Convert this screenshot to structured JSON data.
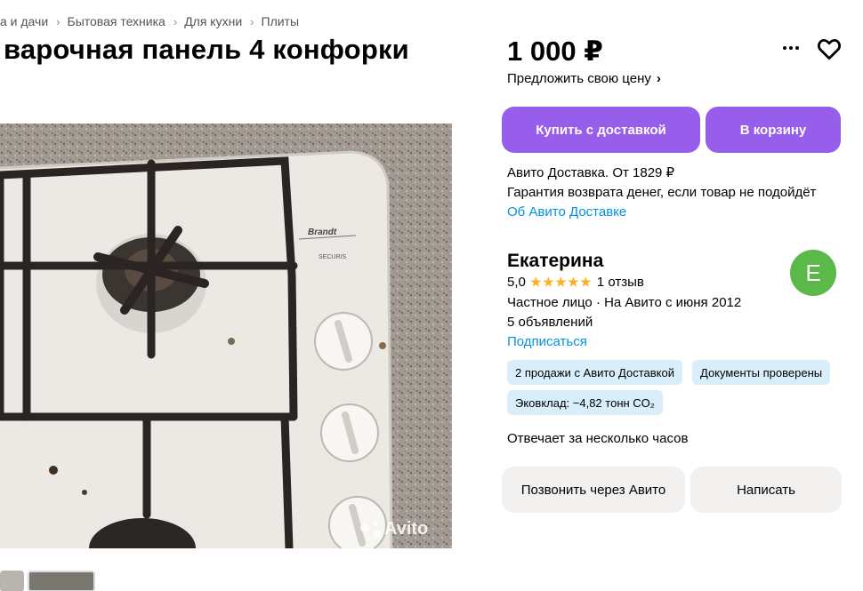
{
  "breadcrumbs": [
    "а и дачи",
    "Бытовая техника",
    "Для кухни",
    "Плиты"
  ],
  "title": "варочная панель 4 конфорки",
  "photo": {
    "brand_text": "Brandt",
    "model_text": "SECURIS",
    "watermark": "Avito"
  },
  "price": "1 000 ₽",
  "offer_price": "Предложить свою цену",
  "actions": {
    "buy": "Купить с доставкой",
    "cart": "В корзину"
  },
  "delivery": {
    "line1": "Авито Доставка. От 1829 ₽",
    "line2": "Гарантия возврата денег, если товар не подойдёт",
    "link": "Об Авито Доставке"
  },
  "seller": {
    "name": "Екатерина",
    "rating": "5,0",
    "stars": 5,
    "reviews": "1 отзыв",
    "type": "Частное лицо · На Авито с июня 2012",
    "ads": "5 объявлений",
    "subscribe": "Подписаться",
    "avatar_letter": "Е",
    "avatar_color": "#5bb949"
  },
  "badges": [
    "2 продажи с Авито Доставкой",
    "Документы проверены",
    "Эковклад: −4,82 тонн CO₂"
  ],
  "reply_time": "Отвечает за несколько часов",
  "contact": {
    "call": "Позвонить через Авито",
    "write": "Написать"
  },
  "colors": {
    "primary": "#965eeb",
    "link": "#0094e0",
    "badge_bg": "#d8eefb",
    "star": "#ffb021"
  },
  "icons": {
    "more": "more-dots-icon",
    "favorite": "heart-icon",
    "offer_chevron": "chevron-right-icon"
  }
}
